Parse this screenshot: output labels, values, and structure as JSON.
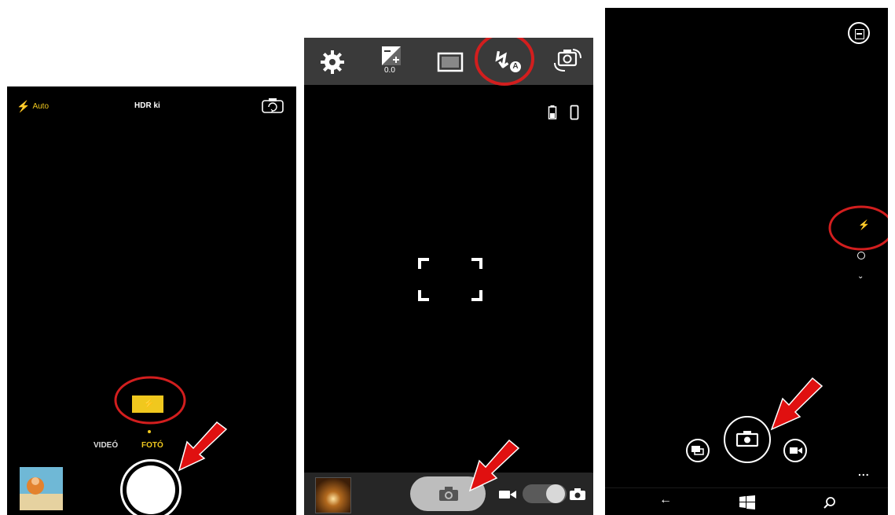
{
  "colors": {
    "accent_yellow": "#f0c81e",
    "circle_red": "#d21e1e",
    "arrow_red": "#e01010",
    "toolbar_gray": "#3a3a3a",
    "bottom_gray": "#262626"
  },
  "ios": {
    "flash_mode": "Auto",
    "hdr_label": "HDR ki",
    "modes": [
      "VIDEÓ",
      "FOTÓ"
    ],
    "active_mode": "FOTÓ",
    "icons": [
      "flash-icon",
      "switch-camera-icon",
      "flash-toggle-icon",
      "shutter-button",
      "thumbnail"
    ]
  },
  "android": {
    "exposure_value": "0.0",
    "icons": [
      "settings-icon",
      "exposure-icon",
      "aspect-ratio-icon",
      "flash-auto-icon",
      "switch-camera-icon",
      "battery-icon",
      "phone-icon",
      "focus-frame",
      "camera-icon",
      "video-icon",
      "photo-icon"
    ]
  },
  "windows": {
    "icons": [
      "menu-icon",
      "flash-icon",
      "settings-icon",
      "chevron-down-icon",
      "photo-mode-icon",
      "camera-icon",
      "video-icon",
      "back-icon",
      "windows-icon",
      "search-icon"
    ],
    "more": "..."
  }
}
